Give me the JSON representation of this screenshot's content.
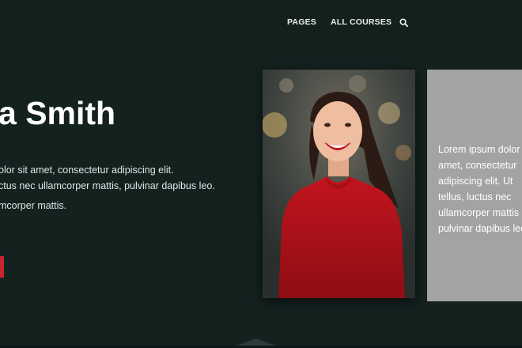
{
  "nav": {
    "items": [
      {
        "label": "PAGES"
      },
      {
        "label": "ALL COURSES"
      }
    ],
    "search_icon": "search-icon"
  },
  "hero": {
    "title": "a Smith",
    "lines": [
      "olor sit amet, consectetur adipiscing elit.",
      "ctus nec ullamcorper mattis, pulvinar dapibus leo.",
      "mcorper mattis."
    ],
    "cta_color": "#c7262c"
  },
  "panel": {
    "lines": [
      "Lorem ipsum dolor",
      "amet, consectetur",
      "adipiscing elit. Ut",
      "tellus, luctus nec",
      "ullamcorper mattis",
      "pulvinar dapibus leo."
    ],
    "background": "#a3a3a3"
  },
  "colors": {
    "background": "#13211f",
    "accent": "#c7262c"
  }
}
